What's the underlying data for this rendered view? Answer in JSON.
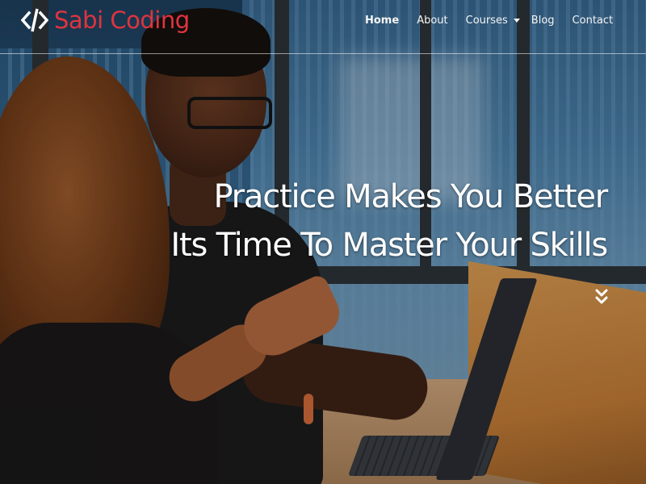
{
  "brand": {
    "name": "Sabi Coding",
    "icon": "code-brackets-icon",
    "color": "#e0343f"
  },
  "nav": {
    "items": [
      {
        "label": "Home",
        "active": true
      },
      {
        "label": "About",
        "active": false
      },
      {
        "label": "Courses",
        "active": false,
        "has_dropdown": true
      },
      {
        "label": "Blog",
        "active": false
      },
      {
        "label": "Contact",
        "active": false
      }
    ]
  },
  "hero": {
    "line1": "Practice Makes You Better",
    "line2": "Its Time To Master Your Skills",
    "scroll_icon": "double-chevron-down-icon"
  }
}
